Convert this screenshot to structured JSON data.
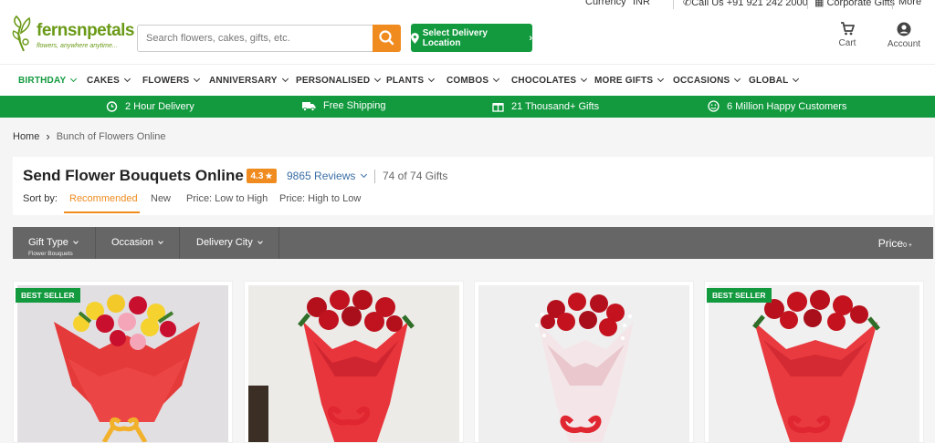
{
  "topbar": {
    "currency_label": "Currency",
    "currency_value": "INR",
    "call_text": "Call Us +91 921 242 2000",
    "corporate_text": "Corporate Gifts",
    "more_text": "More"
  },
  "header": {
    "brand": "fernsnpetals",
    "tagline": "flowers, anywhere anytime...",
    "search_placeholder": "Search flowers, cakes, gifts, etc.",
    "delivery_button": "Select Delivery Location",
    "cart_label": "Cart",
    "account_label": "Account"
  },
  "nav": [
    {
      "label": "BIRTHDAY",
      "active": true
    },
    {
      "label": "CAKES"
    },
    {
      "label": "FLOWERS"
    },
    {
      "label": "ANNIVERSARY"
    },
    {
      "label": "PERSONALISED"
    },
    {
      "label": "PLANTS"
    },
    {
      "label": "COMBOS"
    },
    {
      "label": "CHOCOLATES"
    },
    {
      "label": "MORE GIFTS"
    },
    {
      "label": "OCCASIONS"
    },
    {
      "label": "GLOBAL"
    }
  ],
  "strip": [
    {
      "label": "2 Hour Delivery",
      "icon": "alarm-clock-icon"
    },
    {
      "label": "Free Shipping",
      "icon": "truck-icon"
    },
    {
      "label": "21 Thousand+ Gifts",
      "icon": "gift-icon"
    },
    {
      "label": "6 Million Happy Customers",
      "icon": "smiley-icon"
    }
  ],
  "breadcrumb": {
    "home": "Home",
    "current": "Bunch of Flowers Online"
  },
  "listing": {
    "title": "Send Flower Bouquets Online",
    "rating": "4.3",
    "reviews": "9865 Reviews",
    "count": "74 of 74 Gifts",
    "sort_label": "Sort by:",
    "sort_options": [
      "Recommended",
      "New",
      "Price: Low to High",
      "Price: High to Low"
    ]
  },
  "filters": {
    "gift_type": "Gift Type",
    "gift_type_value": "Flower Bouquets",
    "occasion": "Occasion",
    "delivery_city": "Delivery City",
    "price": "Price",
    "price_value": "0 +"
  },
  "products": [
    {
      "badge": "BEST SELLER",
      "image": "mixed-roses-bouquet"
    },
    {
      "badge": "",
      "image": "red-roses-bouquet"
    },
    {
      "badge": "",
      "image": "red-roses-white-wrap-bouquet"
    },
    {
      "badge": "BEST SELLER",
      "image": "red-roses-bouquet"
    }
  ],
  "colors": {
    "green": "#139a3f",
    "orange": "#f08b1f",
    "filter_bar": "#666666",
    "link_blue": "#3a6ea5"
  }
}
